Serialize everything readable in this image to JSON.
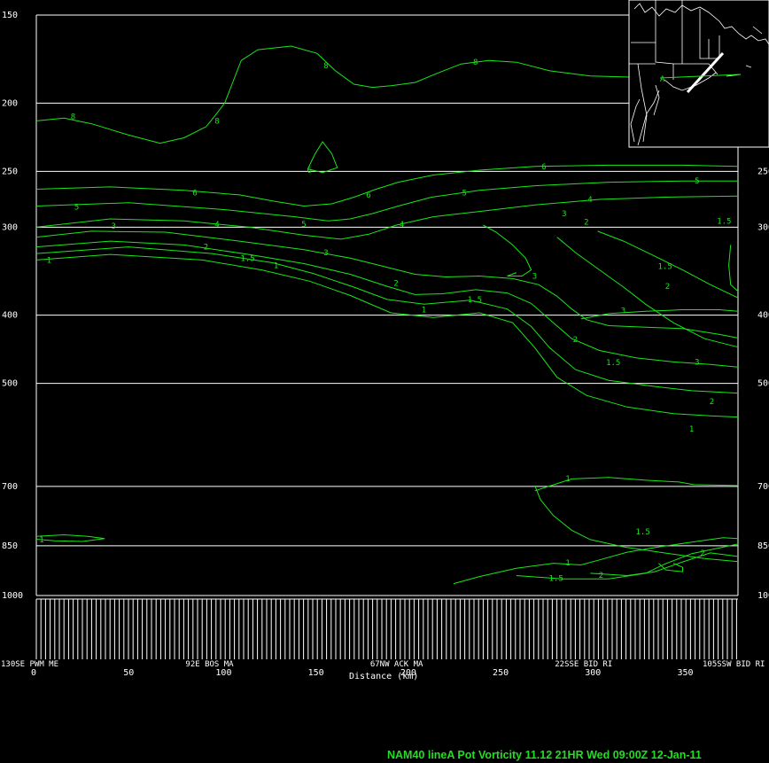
{
  "chart_data": {
    "type": "contour",
    "title": "NAM40 lineA  Pot Vorticity  11.12  21HR Wed 09:00Z 12-Jan-11",
    "xlabel": "Distance (km)",
    "ylabel": "",
    "xlim": [
      0,
      380
    ],
    "ylim": [
      1000,
      150
    ],
    "y_scale": "log",
    "x_ticks": [
      0,
      50,
      100,
      150,
      200,
      250,
      300,
      350
    ],
    "pressure_levels": [
      150,
      200,
      250,
      300,
      400,
      500,
      700,
      850,
      1000
    ],
    "locations": [
      {
        "x": 0,
        "label": "130SE PWM ME"
      },
      {
        "x": 100,
        "label": "92E BOS MA"
      },
      {
        "x": 200,
        "label": "67NW ACK MA"
      },
      {
        "x": 300,
        "label": "22SSE BID RI"
      },
      {
        "x": 380,
        "label": "105SSW BID RI"
      }
    ],
    "series": [
      {
        "name": "8",
        "points": [
          [
            0,
            212
          ],
          [
            15,
            210
          ],
          [
            30,
            214
          ],
          [
            50,
            222
          ],
          [
            67,
            228
          ],
          [
            80,
            224
          ],
          [
            92,
            216
          ],
          [
            97,
            208
          ],
          [
            102,
            200
          ],
          [
            106,
            188
          ],
          [
            111,
            174
          ],
          [
            120,
            168
          ],
          [
            138,
            166
          ],
          [
            152,
            170
          ],
          [
            162,
            180
          ],
          [
            172,
            188
          ],
          [
            182,
            190
          ],
          [
            192,
            189
          ],
          [
            205,
            187
          ],
          [
            218,
            181
          ],
          [
            230,
            176
          ],
          [
            245,
            174
          ],
          [
            260,
            175
          ],
          [
            278,
            180
          ],
          [
            300,
            183
          ],
          [
            330,
            184
          ],
          [
            355,
            184
          ],
          [
            380,
            183
          ]
        ]
      },
      {
        "name": "6",
        "points": [
          [
            147,
            248
          ],
          [
            151,
            236
          ],
          [
            155,
            227
          ],
          [
            160,
            236
          ],
          [
            163,
            247
          ],
          [
            155,
            251
          ],
          [
            147,
            248
          ]
        ]
      },
      {
        "name": "6",
        "points": [
          [
            0,
            265
          ],
          [
            40,
            263
          ],
          [
            80,
            266
          ],
          [
            110,
            270
          ],
          [
            130,
            276
          ],
          [
            145,
            280
          ],
          [
            160,
            278
          ],
          [
            172,
            272
          ],
          [
            184,
            265
          ],
          [
            196,
            259
          ],
          [
            215,
            253
          ],
          [
            240,
            249
          ],
          [
            270,
            246
          ],
          [
            310,
            245
          ],
          [
            350,
            245
          ],
          [
            380,
            246
          ]
        ]
      },
      {
        "name": "5",
        "points": [
          [
            0,
            280
          ],
          [
            50,
            277
          ],
          [
            100,
            283
          ],
          [
            140,
            290
          ],
          [
            158,
            294
          ],
          [
            170,
            292
          ],
          [
            182,
            287
          ],
          [
            196,
            280
          ],
          [
            214,
            272
          ],
          [
            240,
            266
          ],
          [
            270,
            262
          ],
          [
            310,
            259
          ],
          [
            350,
            258
          ],
          [
            380,
            258
          ]
        ]
      },
      {
        "name": "4",
        "points": [
          [
            0,
            300
          ],
          [
            40,
            292
          ],
          [
            80,
            294
          ],
          [
            115,
            300
          ],
          [
            145,
            308
          ],
          [
            165,
            312
          ],
          [
            180,
            307
          ],
          [
            195,
            298
          ],
          [
            215,
            290
          ],
          [
            240,
            285
          ],
          [
            270,
            279
          ],
          [
            305,
            274
          ],
          [
            340,
            272
          ],
          [
            380,
            271
          ]
        ]
      },
      {
        "name": "3",
        "points": [
          [
            0,
            310
          ],
          [
            30,
            304
          ],
          [
            70,
            305
          ],
          [
            110,
            314
          ],
          [
            145,
            323
          ],
          [
            170,
            332
          ],
          [
            190,
            342
          ],
          [
            205,
            350
          ],
          [
            222,
            353
          ],
          [
            240,
            352
          ],
          [
            258,
            355
          ],
          [
            272,
            362
          ],
          [
            282,
            376
          ],
          [
            290,
            392
          ],
          [
            298,
            406
          ],
          [
            310,
            414
          ],
          [
            330,
            416
          ],
          [
            350,
            418
          ],
          [
            370,
            426
          ],
          [
            380,
            431
          ]
        ]
      },
      {
        "name": "3",
        "points": [
          [
            242,
            298
          ],
          [
            249,
            305
          ],
          [
            258,
            318
          ],
          [
            265,
            332
          ],
          [
            268,
            345
          ],
          [
            263,
            352
          ],
          [
            255,
            352
          ],
          [
            260,
            348
          ]
        ]
      },
      {
        "name": "3",
        "points": [
          [
            295,
            405
          ],
          [
            310,
            398
          ],
          [
            330,
            395
          ],
          [
            350,
            393
          ],
          [
            370,
            393
          ],
          [
            380,
            395
          ]
        ]
      },
      {
        "name": "2",
        "points": [
          [
            0,
            320
          ],
          [
            40,
            314
          ],
          [
            80,
            318
          ],
          [
            115,
            328
          ],
          [
            145,
            338
          ],
          [
            170,
            350
          ],
          [
            190,
            364
          ],
          [
            205,
            374
          ],
          [
            220,
            373
          ],
          [
            238,
            368
          ],
          [
            255,
            372
          ],
          [
            268,
            385
          ],
          [
            280,
            410
          ],
          [
            290,
            432
          ],
          [
            305,
            449
          ],
          [
            325,
            460
          ],
          [
            345,
            466
          ],
          [
            365,
            470
          ],
          [
            380,
            474
          ]
        ]
      },
      {
        "name": "1.5",
        "points": [
          [
            0,
            327
          ],
          [
            50,
            320
          ],
          [
            95,
            327
          ],
          [
            128,
            337
          ],
          [
            150,
            349
          ],
          [
            172,
            365
          ],
          [
            190,
            380
          ],
          [
            210,
            386
          ],
          [
            235,
            381
          ],
          [
            255,
            392
          ],
          [
            268,
            415
          ],
          [
            278,
            445
          ],
          [
            292,
            478
          ],
          [
            310,
            495
          ],
          [
            335,
            505
          ],
          [
            355,
            512
          ],
          [
            380,
            516
          ]
        ]
      },
      {
        "name": "1",
        "points": [
          [
            0,
            334
          ],
          [
            40,
            328
          ],
          [
            90,
            334
          ],
          [
            122,
            345
          ],
          [
            148,
            358
          ],
          [
            170,
            375
          ],
          [
            192,
            397
          ],
          [
            215,
            403
          ],
          [
            240,
            397
          ],
          [
            258,
            410
          ],
          [
            270,
            445
          ],
          [
            282,
            490
          ],
          [
            298,
            520
          ],
          [
            320,
            540
          ],
          [
            345,
            552
          ],
          [
            365,
            556
          ],
          [
            380,
            558
          ]
        ]
      },
      {
        "name": "2",
        "points": [
          [
            282,
            310
          ],
          [
            292,
            326
          ],
          [
            305,
            345
          ],
          [
            318,
            365
          ],
          [
            330,
            386
          ],
          [
            345,
            410
          ],
          [
            362,
            432
          ],
          [
            380,
            444
          ]
        ]
      },
      {
        "name": "1.5",
        "points": [
          [
            304,
            304
          ],
          [
            318,
            314
          ],
          [
            333,
            328
          ],
          [
            350,
            345
          ],
          [
            365,
            362
          ],
          [
            380,
            378
          ]
        ]
      },
      {
        "name": "1.5",
        "points": [
          [
            376,
            318
          ],
          [
            375,
            340
          ],
          [
            376,
            362
          ],
          [
            380,
            370
          ]
        ]
      },
      {
        "name": "1",
        "points": [
          [
            0,
            824
          ],
          [
            15,
            820
          ],
          [
            28,
            824
          ],
          [
            37,
            830
          ],
          [
            25,
            838
          ],
          [
            10,
            836
          ],
          [
            0,
            832
          ]
        ]
      },
      {
        "name": "1",
        "points": [
          [
            270,
            710
          ],
          [
            290,
            683
          ],
          [
            310,
            680
          ],
          [
            330,
            686
          ],
          [
            348,
            690
          ],
          [
            356,
            696
          ],
          [
            380,
            698
          ]
        ]
      },
      {
        "name": "1",
        "points": [
          [
            270,
            698
          ],
          [
            273,
            731
          ],
          [
            280,
            770
          ],
          [
            290,
            808
          ],
          [
            300,
            833
          ],
          [
            318,
            853
          ],
          [
            340,
            870
          ],
          [
            362,
            886
          ],
          [
            380,
            895
          ]
        ]
      },
      {
        "name": "1.5",
        "points": [
          [
            260,
            937
          ],
          [
            285,
            947
          ],
          [
            310,
            947
          ],
          [
            330,
            930
          ],
          [
            340,
            903
          ],
          [
            355,
            872
          ],
          [
            380,
            845
          ]
        ]
      },
      {
        "name": "2",
        "points": [
          [
            300,
            930
          ],
          [
            320,
            937
          ],
          [
            335,
            925
          ],
          [
            350,
            896
          ],
          [
            365,
            870
          ],
          [
            380,
            880
          ]
        ]
      },
      {
        "name": "2",
        "points": [
          [
            337,
            900
          ],
          [
            341,
            920
          ],
          [
            350,
            925
          ],
          [
            350,
            912
          ],
          [
            345,
            900
          ]
        ]
      },
      {
        "name": "1",
        "points": [
          [
            226,
            962
          ],
          [
            240,
            940
          ],
          [
            260,
            915
          ],
          [
            280,
            900
          ],
          [
            295,
            905
          ],
          [
            305,
            890
          ],
          [
            320,
            868
          ],
          [
            335,
            855
          ],
          [
            355,
            840
          ],
          [
            372,
            828
          ],
          [
            380,
            830
          ]
        ]
      }
    ],
    "contour_labels": [
      {
        "text": "8",
        "x": 20,
        "y": 209
      },
      {
        "text": "8",
        "x": 98,
        "y": 212
      },
      {
        "text": "8",
        "x": 157,
        "y": 177
      },
      {
        "text": "8",
        "x": 238,
        "y": 175
      },
      {
        "text": "6",
        "x": 148,
        "y": 249
      },
      {
        "text": "6",
        "x": 86,
        "y": 268
      },
      {
        "text": "6",
        "x": 180,
        "y": 270
      },
      {
        "text": "6",
        "x": 275,
        "y": 246
      },
      {
        "text": "5",
        "x": 22,
        "y": 281
      },
      {
        "text": "5",
        "x": 145,
        "y": 297
      },
      {
        "text": "5",
        "x": 232,
        "y": 268
      },
      {
        "text": "5",
        "x": 358,
        "y": 258
      },
      {
        "text": "4",
        "x": 98,
        "y": 297
      },
      {
        "text": "4",
        "x": 198,
        "y": 297
      },
      {
        "text": "4",
        "x": 300,
        "y": 274
      },
      {
        "text": "3",
        "x": 42,
        "y": 299
      },
      {
        "text": "3",
        "x": 157,
        "y": 326
      },
      {
        "text": "3",
        "x": 270,
        "y": 352
      },
      {
        "text": "3",
        "x": 286,
        "y": 287
      },
      {
        "text": "3",
        "x": 318,
        "y": 394
      },
      {
        "text": "3",
        "x": 358,
        "y": 466
      },
      {
        "text": "2",
        "x": 92,
        "y": 320
      },
      {
        "text": "2",
        "x": 195,
        "y": 360
      },
      {
        "text": "2",
        "x": 298,
        "y": 295
      },
      {
        "text": "2",
        "x": 292,
        "y": 433
      },
      {
        "text": "2",
        "x": 342,
        "y": 364
      },
      {
        "text": "2",
        "x": 366,
        "y": 530
      },
      {
        "text": "1.5",
        "x": 112,
        "y": 332
      },
      {
        "text": "1.5",
        "x": 235,
        "y": 380
      },
      {
        "text": "1.5",
        "x": 370,
        "y": 294
      },
      {
        "text": "1.5",
        "x": 338,
        "y": 341
      },
      {
        "text": "1.5",
        "x": 310,
        "y": 467
      },
      {
        "text": "1.5",
        "x": 326,
        "y": 812
      },
      {
        "text": "1.5",
        "x": 279,
        "y": 945
      },
      {
        "text": "1",
        "x": 7,
        "y": 334
      },
      {
        "text": "1",
        "x": 130,
        "y": 340
      },
      {
        "text": "1",
        "x": 210,
        "y": 393
      },
      {
        "text": "1",
        "x": 355,
        "y": 580
      },
      {
        "text": "1",
        "x": 3,
        "y": 833
      },
      {
        "text": "1",
        "x": 288,
        "y": 682
      },
      {
        "text": "1",
        "x": 288,
        "y": 898
      },
      {
        "text": "2",
        "x": 306,
        "y": 936
      },
      {
        "text": "2",
        "x": 361,
        "y": 870
      }
    ]
  },
  "inset_map": {
    "description_icon": "locator-map-icon",
    "line_label": "A"
  }
}
